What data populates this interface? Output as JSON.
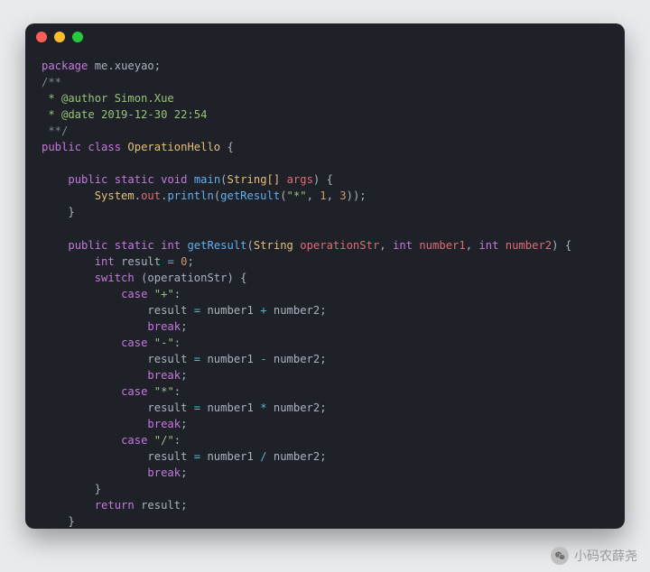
{
  "window": {
    "buttons": [
      "close",
      "minimize",
      "zoom"
    ]
  },
  "code": {
    "package_kw": "package",
    "package_name": "me.xueyao",
    "doc_open": "/**",
    "doc_author": " * @author Simon.Xue",
    "doc_date": " * @date 2019-12-30 22:54",
    "doc_close": " **/",
    "public": "public",
    "class_kw": "class",
    "class_name": "OperationHello",
    "static": "static",
    "void": "void",
    "int": "int",
    "main": "main",
    "string_arr": "String[]",
    "args": "args",
    "system": "System",
    "out": "out",
    "println": "println",
    "getResult": "getResult",
    "string": "String",
    "operationStr": "operationStr",
    "number1": "number1",
    "number2": "number2",
    "result": "result",
    "zero": "0",
    "one": "1",
    "three": "3",
    "switch": "switch",
    "case": "case",
    "break": "break",
    "return": "return",
    "str_star": "\"*\"",
    "str_plus": "\"+\"",
    "str_minus": "\"-\"",
    "str_star2": "\"*\"",
    "str_slash": "\"/\""
  },
  "watermark": {
    "text": "小码农薛尧"
  }
}
